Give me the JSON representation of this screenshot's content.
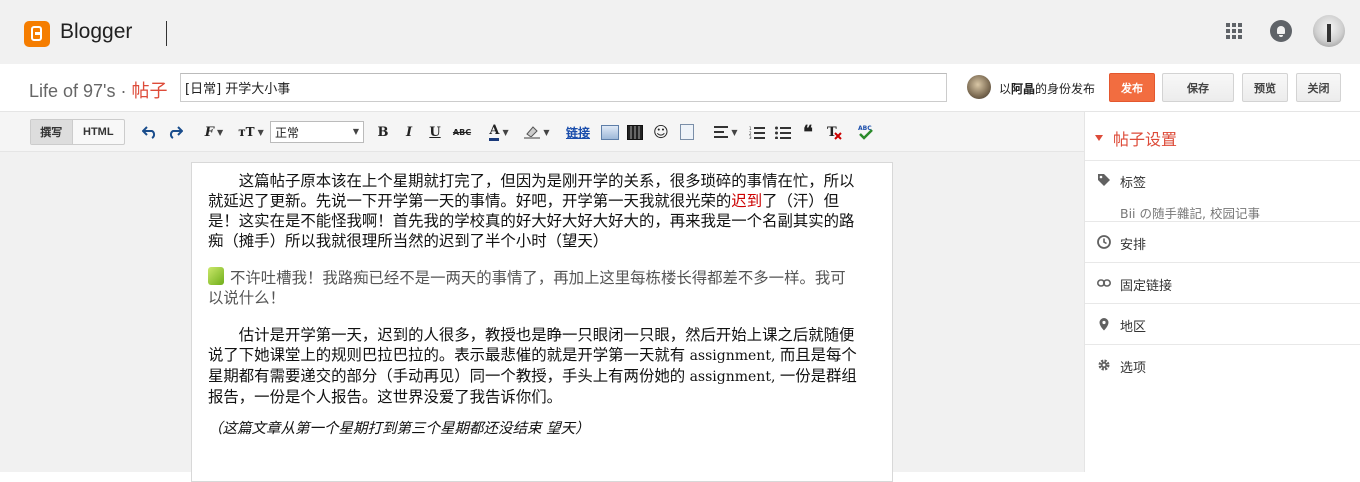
{
  "app": {
    "brand": "Blogger",
    "accent_color": "#f57d00",
    "icons": [
      "apps-grid-icon",
      "notifications-bell-icon",
      "account-avatar"
    ]
  },
  "post_header": {
    "blog_name": "Life of 97's",
    "separator": " · ",
    "section_label": "帖子",
    "title_value": "[日常] 开学大小事",
    "author_prefix": "以",
    "author_name": "阿晶",
    "author_suffix": "的身份发布",
    "publish_label": "发布",
    "save_label": "保存",
    "preview_label": "预览",
    "close_label": "关闭",
    "publish_color": "#f26d40"
  },
  "toolbar": {
    "compose_label": "撰写",
    "html_label": "HTML",
    "font_size_value": "正常",
    "link_label": "链接",
    "icons": [
      "undo-icon",
      "redo-icon",
      "font-icon",
      "font-size-icon",
      "bold-icon",
      "italic-icon",
      "underline-icon",
      "strikethrough-icon",
      "text-color-icon",
      "highlight-color-icon",
      "link",
      "image-icon",
      "video-icon",
      "emoji-icon",
      "jump-break-icon",
      "align-icon",
      "numbered-list-icon",
      "bulleted-list-icon",
      "quote-icon",
      "clear-format-icon",
      "spellcheck-icon"
    ]
  },
  "editor": {
    "p1_before": "　　这篇帖子原本该在上个星期就打完了，但因为是刚开学的关系，很多琐碎的事情在忙，所以就延迟了更新。先说一下开学第一天的事情。好吧，开学第一天我就很光荣的",
    "p1_link": "迟到",
    "p1_after": "了（汗）但是！这实在是不能怪我啊！首先我的学校真的好大好大好大好大的，再来我是一个名副其实的路痴（摊手）所以我就很理所当然的迟到了半个小时（望天）",
    "p2": "不许吐槽我！我路痴已经不是一两天的事情了，再加上这里每栋楼长得都差不多一样。我可以说什么！",
    "p3_a": "　　估计是开学第一天，迟到的人很多，教授也是睁一只眼闭一只眼，然后开始上课之后就随便说了下她课堂上的规则巴拉巴拉的。表示最悲催的就是开学第一天就有",
    "p3_eng1": " assignment, ",
    "p3_b": "而且是每个星期都有需要递交的部分（手动再见）同一个教授，手头上有两份她的",
    "p3_eng2": " assignment, ",
    "p3_c": "一份是群组报告，一份是个人报告。这世界没爱了我告诉你们。",
    "p4": "（这篇文章从第一个星期打到第三个星期都还没结束 望天）",
    "link_color": "#cc0000"
  },
  "sidepanel": {
    "title": "帖子设置",
    "labels_label": "标签",
    "labels_value": "Bii の随手雜記, 校园记事",
    "schedule_label": "安排",
    "permalink_label": "固定链接",
    "location_label": "地区",
    "options_label": "选项"
  }
}
